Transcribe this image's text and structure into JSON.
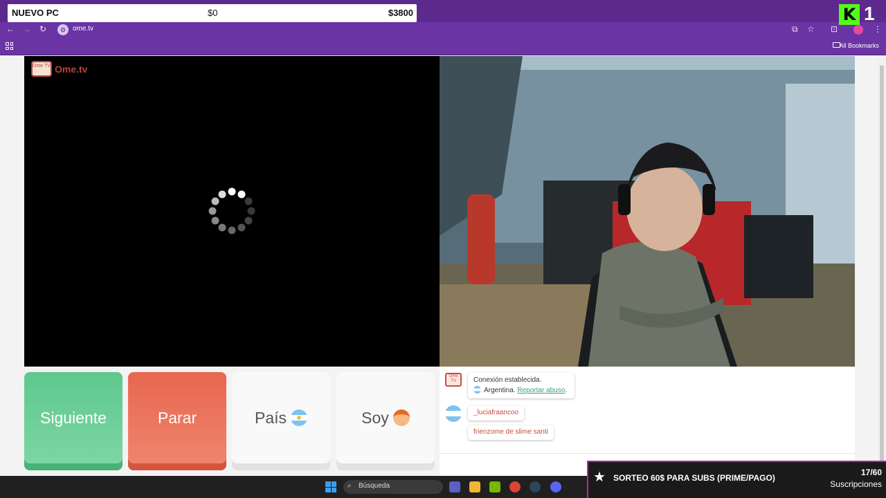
{
  "tracker": {
    "title": "NUEVO PC",
    "current": "$0",
    "goal": "$3800"
  },
  "kick_overlay": {
    "logo": "K",
    "digit": "1"
  },
  "browser": {
    "url": "ome.tv",
    "bookmarks_label": "All Bookmarks",
    "nav_icons": [
      "back-icon",
      "forward-icon",
      "reload-icon"
    ],
    "right_icons": [
      "cast-icon",
      "star-icon",
      "extensions-icon",
      "profile-icon",
      "menu-icon"
    ]
  },
  "ome": {
    "logo_text": "Ome.tv",
    "logo_badge": "Ome TV"
  },
  "buttons": {
    "next": "Siguiente",
    "stop": "Parar",
    "country": "País",
    "soy": "Soy"
  },
  "chat": {
    "system_line1": "Conexión establecida.",
    "system_country": "Argentina.",
    "report_link": "Reportar abuso",
    "report_period": ".",
    "messages": [
      "_luciafraancoo",
      "frienzome de slime santi"
    ]
  },
  "subgoal": {
    "label": "SORTEO 60$ PARA SUBS (PRIME/PAGO)",
    "count": "17/60",
    "unit": "Suscripciones"
  },
  "taskbar": {
    "search": "Búsqueda",
    "apps": [
      "start-icon",
      "search-icon",
      "meet-icon",
      "files-icon",
      "nvidia-icon",
      "chrome-icon",
      "steam-icon",
      "discord-icon"
    ]
  },
  "colors": {
    "next": "#5dc88d",
    "stop": "#e8674f",
    "chrome": "#6b34a4",
    "accent": "#a72ba8"
  }
}
